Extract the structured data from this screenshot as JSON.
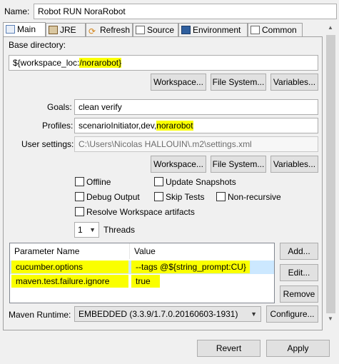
{
  "header": {
    "name_label": "Name:",
    "name_value": "Robot RUN NoraRobot"
  },
  "tabs": [
    {
      "label": "Main"
    },
    {
      "label": "JRE"
    },
    {
      "label": "Refresh"
    },
    {
      "label": "Source"
    },
    {
      "label": "Environment"
    },
    {
      "label": "Common"
    }
  ],
  "main": {
    "base_dir_label": "Base directory:",
    "base_dir_prefix": "${workspace_loc:",
    "base_dir_highlight": "/norarobot}",
    "buttons_row1": {
      "workspace": "Workspace...",
      "file_system": "File System...",
      "variables": "Variables..."
    },
    "goals_label": "Goals:",
    "goals_value": "clean verify",
    "profiles_label": "Profiles:",
    "profiles_prefix": "scenarioInitiator,dev,",
    "profiles_highlight": "norarobot",
    "user_settings_label": "User settings:",
    "user_settings_value": "C:\\Users\\Nicolas HALLOUIN\\.m2\\settings.xml",
    "buttons_row2": {
      "workspace": "Workspace...",
      "file_system": "File System...",
      "variables": "Variables..."
    },
    "checkboxes": {
      "offline": "Offline",
      "update_snapshots": "Update Snapshots",
      "debug_output": "Debug Output",
      "skip_tests": "Skip Tests",
      "non_recursive": "Non-recursive",
      "resolve_workspace": "Resolve Workspace artifacts"
    },
    "threads_value": "1",
    "threads_label": "Threads",
    "params_table": {
      "headers": [
        "Parameter Name",
        "Value"
      ],
      "rows": [
        {
          "name": "cucumber.options",
          "value": "--tags @${string_prompt:CU}"
        },
        {
          "name": "maven.test.failure.ignore",
          "value": "true"
        }
      ]
    },
    "param_buttons": {
      "add": "Add...",
      "edit": "Edit...",
      "remove": "Remove"
    },
    "runtime_label": "Maven Runtime:",
    "runtime_value": "EMBEDDED (3.3.9/1.7.0.20160603-1931)",
    "configure": "Configure..."
  },
  "footer": {
    "revert": "Revert",
    "apply": "Apply"
  }
}
